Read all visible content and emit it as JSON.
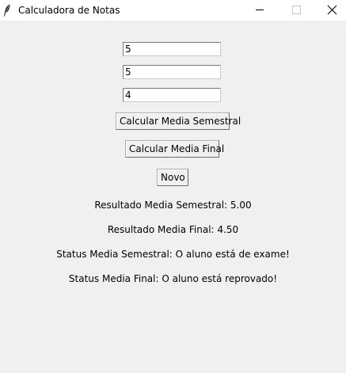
{
  "window": {
    "title": "Calculadora de Notas",
    "icon": "feather-icon"
  },
  "inputs": {
    "nota1": "5",
    "nota2": "5",
    "nota3": "4"
  },
  "buttons": {
    "calc_semestral": "Calcular Media Semestral",
    "calc_final": "Calcular Media Final",
    "novo": "Novo"
  },
  "results": {
    "media_semestral": "Resultado Media Semestral: 5.00",
    "media_final": "Resultado Media Final: 4.50",
    "status_semestral": "Status Media Semestral: O aluno está de exame!",
    "status_final": "Status Media Final: O aluno está reprovado!"
  }
}
